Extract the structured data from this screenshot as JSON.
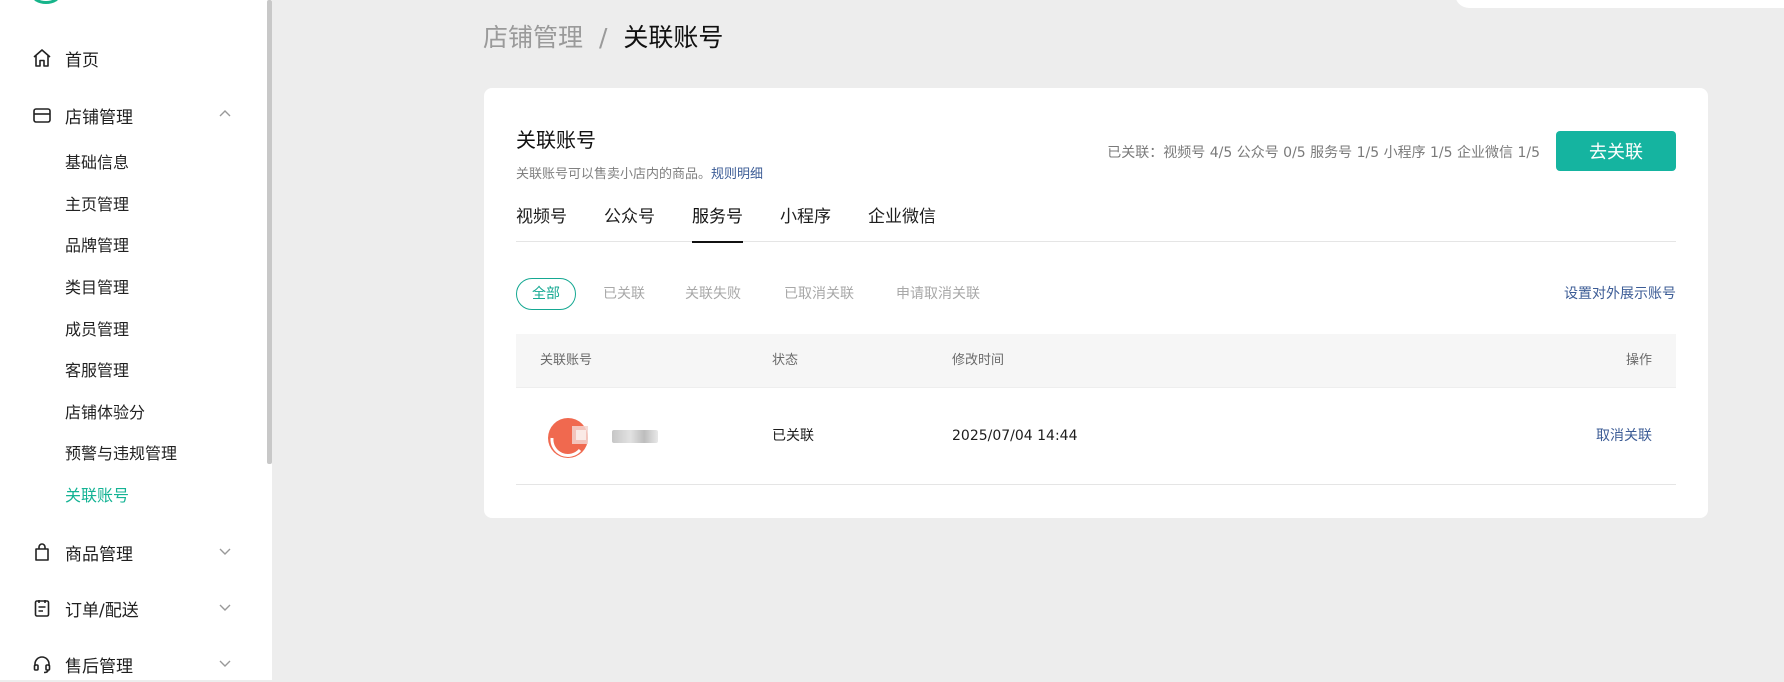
{
  "sidebar": {
    "top_items": [
      {
        "label": "首页",
        "icon": "home-icon"
      },
      {
        "label": "店铺管理",
        "icon": "store-icon",
        "expanded": true
      },
      {
        "label": "商品管理",
        "icon": "shopping-bag-icon",
        "expanded": false
      },
      {
        "label": "订单/配送",
        "icon": "clipboard-icon",
        "expanded": false
      },
      {
        "label": "售后管理",
        "icon": "headset-icon",
        "expanded": false
      }
    ],
    "store_sub_items": [
      {
        "label": "基础信息"
      },
      {
        "label": "主页管理"
      },
      {
        "label": "品牌管理"
      },
      {
        "label": "类目管理"
      },
      {
        "label": "成员管理"
      },
      {
        "label": "客服管理"
      },
      {
        "label": "店铺体验分"
      },
      {
        "label": "预警与违规管理"
      },
      {
        "label": "关联账号",
        "active": true
      }
    ],
    "active_color": "#14b394"
  },
  "breadcrumb": {
    "parent": "店铺管理",
    "separator": "/",
    "current": "关联账号"
  },
  "card": {
    "title": "关联账号",
    "description": "关联账号可以售卖小店内的商品。",
    "rule_link": "规则明细",
    "linked_summary": "已关联：视频号 4/5 公众号 0/5 服务号 1/5 小程序 1/5 企业微信 1/5",
    "go_link_button": "去关联",
    "accent_color": "#15b4a0"
  },
  "tabs": [
    {
      "label": "视频号"
    },
    {
      "label": "公众号"
    },
    {
      "label": "服务号",
      "active": true
    },
    {
      "label": "小程序"
    },
    {
      "label": "企业微信"
    }
  ],
  "filters": [
    {
      "label": "全部",
      "active": true
    },
    {
      "label": "已关联"
    },
    {
      "label": "关联失败"
    },
    {
      "label": "已取消关联"
    },
    {
      "label": "申请取消关联"
    }
  ],
  "set_display_link": "设置对外展示账号",
  "table": {
    "headers": {
      "account": "关联账号",
      "status": "状态",
      "modified": "修改时间",
      "action": "操作"
    },
    "rows": [
      {
        "status": "已关联",
        "modified": "2025/07/04 14:44",
        "action": "取消关联"
      }
    ]
  }
}
